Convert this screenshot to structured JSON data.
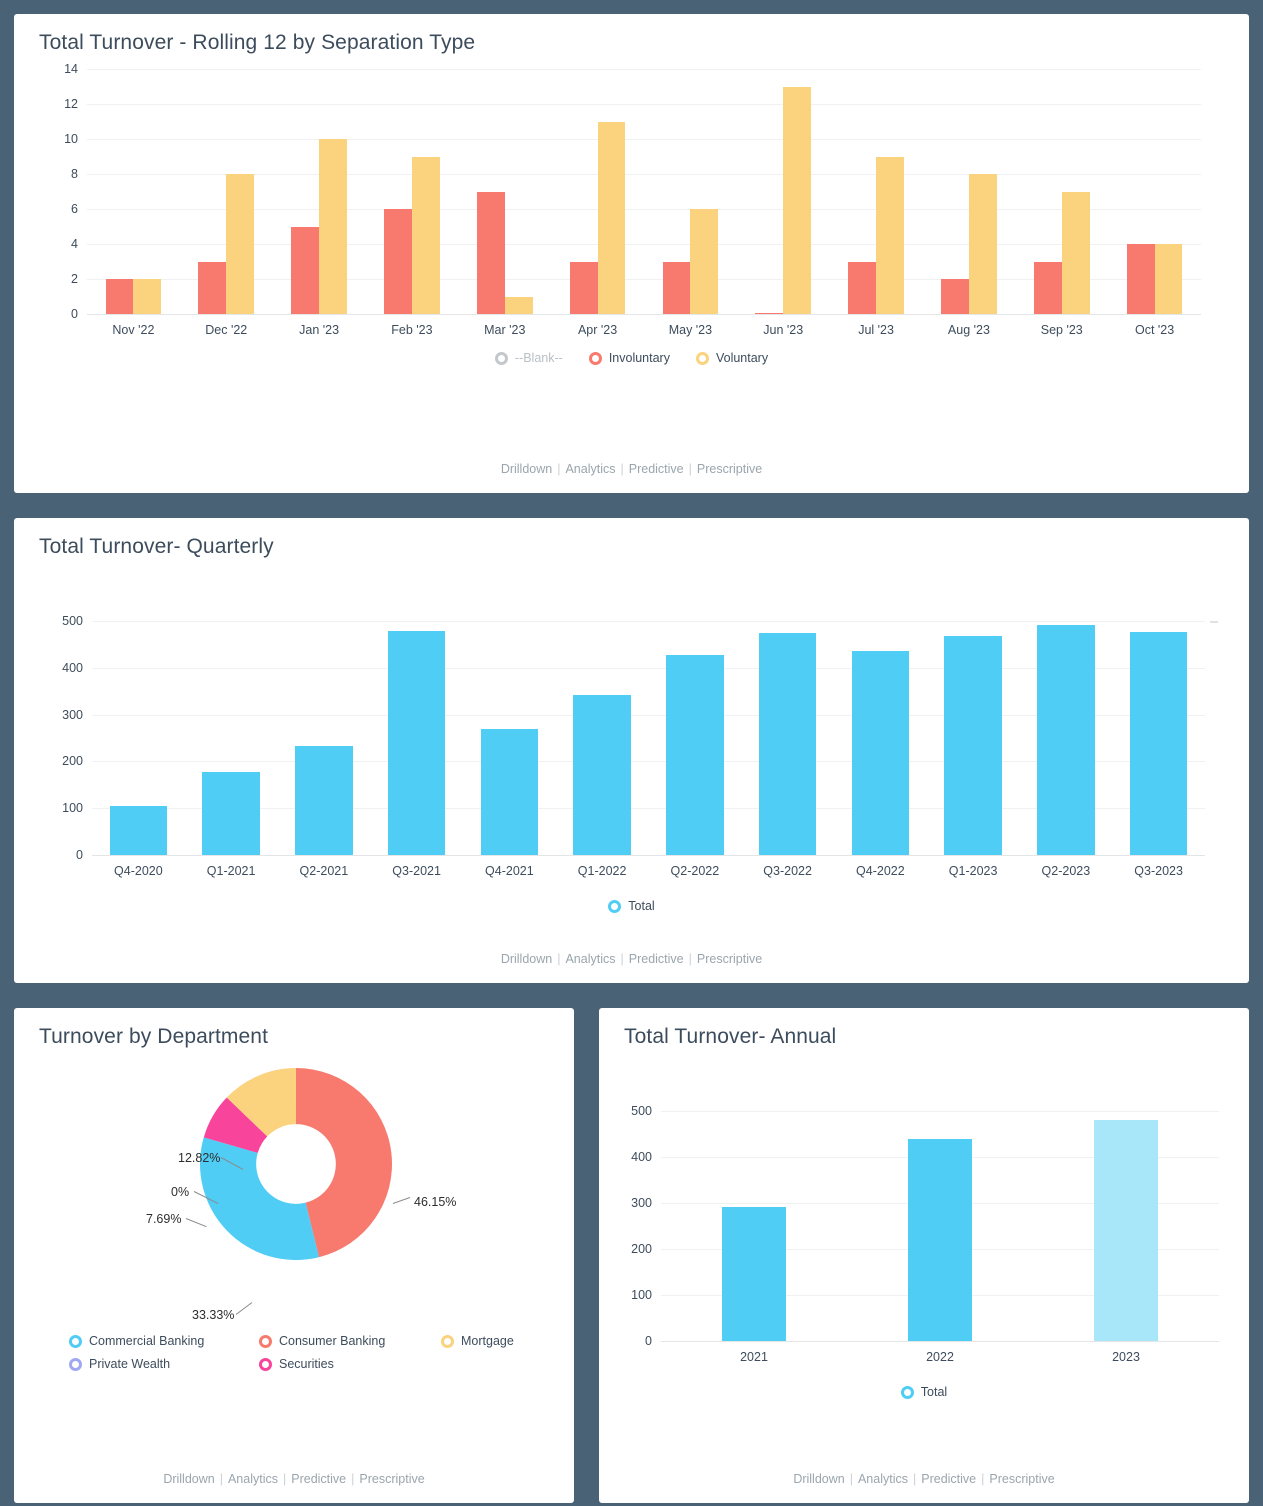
{
  "dashboard": {
    "background_color": "#4a6275",
    "footer_links": [
      "Drilldown",
      "Analytics",
      "Predictive",
      "Prescriptive"
    ]
  },
  "cards": {
    "rolling": {
      "title": "Total Turnover - Rolling 12 by Separation Type"
    },
    "quarterly": {
      "title": "Total Turnover- Quarterly"
    },
    "department": {
      "title": "Turnover by Department"
    },
    "annual": {
      "title": "Total Turnover- Annual"
    }
  },
  "chart_data": [
    {
      "id": "rolling12",
      "type": "bar",
      "title": "Total Turnover - Rolling 12 by Separation Type",
      "xlabel": "",
      "ylabel": "",
      "ylim": [
        0,
        14
      ],
      "yticks": [
        0,
        2,
        4,
        6,
        8,
        10,
        12,
        14
      ],
      "grid": true,
      "legend_position": "bottom",
      "categories": [
        "Nov '22",
        "Dec '22",
        "Jan '23",
        "Feb '23",
        "Mar '23",
        "Apr '23",
        "May '23",
        "Jun '23",
        "Jul '23",
        "Aug '23",
        "Sep '23",
        "Oct '23"
      ],
      "series": [
        {
          "name": "--Blank--",
          "color": "#bfc4c8",
          "inactive": true,
          "values": [
            0,
            0,
            0,
            0,
            0,
            0,
            0,
            0,
            0,
            0,
            0,
            0
          ]
        },
        {
          "name": "Involuntary",
          "color": "#f87a6e",
          "values": [
            2,
            3,
            5,
            6,
            7,
            3,
            3,
            0,
            3,
            2,
            3,
            4
          ]
        },
        {
          "name": "Voluntary",
          "color": "#fbd27e",
          "values": [
            2,
            8,
            10,
            9,
            1,
            11,
            6,
            13,
            9,
            8,
            7,
            4
          ]
        }
      ]
    },
    {
      "id": "quarterly",
      "type": "bar",
      "title": "Total Turnover- Quarterly",
      "xlabel": "",
      "ylabel": "",
      "ylim": [
        0,
        500
      ],
      "yticks": [
        0,
        100,
        200,
        300,
        400,
        500
      ],
      "grid": true,
      "legend_position": "bottom",
      "categories": [
        "Q4-2020",
        "Q1-2021",
        "Q2-2021",
        "Q3-2021",
        "Q4-2021",
        "Q1-2022",
        "Q2-2022",
        "Q3-2022",
        "Q4-2022",
        "Q1-2023",
        "Q2-2023",
        "Q3-2023"
      ],
      "series": [
        {
          "name": "Total",
          "color": "#4fcdf5",
          "values": [
            105,
            178,
            233,
            478,
            270,
            342,
            428,
            475,
            436,
            468,
            492,
            477
          ]
        }
      ]
    },
    {
      "id": "department",
      "type": "pie",
      "subtype": "donut",
      "title": "Turnover by Department",
      "legend_position": "bottom",
      "labels": [
        "Commercial Banking",
        "Consumer Banking",
        "Mortgage",
        "Private Wealth",
        "Securities"
      ],
      "slices": [
        {
          "name": "Consumer Banking",
          "percent": 46.15,
          "label": "46.15%",
          "color": "#f87a6e"
        },
        {
          "name": "Commercial Banking",
          "percent": 33.33,
          "label": "33.33%",
          "color": "#4fcdf5"
        },
        {
          "name": "Securities",
          "percent": 7.69,
          "label": "7.69%",
          "color": "#f8449b"
        },
        {
          "name": "Private Wealth",
          "percent": 0,
          "label": "0%",
          "color": "#9fa8f0"
        },
        {
          "name": "Mortgage",
          "percent": 12.82,
          "label": "12.82%",
          "color": "#fbd27e"
        }
      ],
      "legend": [
        {
          "name": "Commercial Banking",
          "color": "#4fcdf5"
        },
        {
          "name": "Consumer Banking",
          "color": "#f87a6e"
        },
        {
          "name": "Mortgage",
          "color": "#fbd27e"
        },
        {
          "name": "Private Wealth",
          "color": "#9fa8f0"
        },
        {
          "name": "Securities",
          "color": "#f8449b"
        }
      ]
    },
    {
      "id": "annual",
      "type": "bar",
      "title": "Total Turnover- Annual",
      "xlabel": "",
      "ylabel": "",
      "ylim": [
        0,
        500
      ],
      "yticks": [
        0,
        100,
        200,
        300,
        400,
        500
      ],
      "grid": true,
      "legend_position": "bottom",
      "categories": [
        "2021",
        "2022",
        "2023"
      ],
      "series": [
        {
          "name": "Total",
          "color": "#4fcdf5",
          "values": [
            292,
            440,
            480
          ],
          "bar_colors": [
            "#4fcdf5",
            "#4fcdf5",
            "#a8e6fa"
          ]
        }
      ]
    }
  ]
}
